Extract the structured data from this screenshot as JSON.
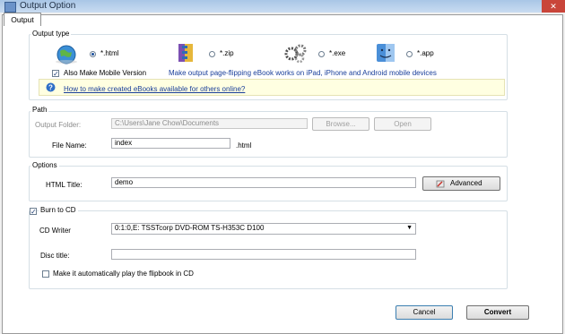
{
  "window": {
    "title": "Output Option",
    "close_glyph": "✕"
  },
  "tab": {
    "label": "Output"
  },
  "output_type": {
    "title": "Output type",
    "options": [
      {
        "label": "*.html",
        "selected": true
      },
      {
        "label": "*.zip",
        "selected": false
      },
      {
        "label": "*.exe",
        "selected": false
      },
      {
        "label": "*.app",
        "selected": false
      }
    ],
    "mobile_checkbox_label": "Also Make Mobile Version",
    "mobile_checked": true,
    "mobile_hint": "Make output page-flipping eBook works on iPad, iPhone and Android mobile devices",
    "help_link": "How to make created eBooks available for others online?"
  },
  "path": {
    "title": "Path",
    "output_folder_label": "Output Folder:",
    "output_folder_value": "C:\\Users\\Jane Chow\\Documents",
    "browse_label": "Browse...",
    "open_label": "Open",
    "file_name_label": "File Name:",
    "file_name_value": "index",
    "file_ext": ".html"
  },
  "options": {
    "title": "Options",
    "html_title_label": "HTML Title:",
    "html_title_value": "demo",
    "advanced_label": "Advanced"
  },
  "burn": {
    "checkbox_label": "Burn to CD",
    "checked": true,
    "cd_writer_label": "CD Writer",
    "cd_writer_value": "0:1:0,E: TSSTcorp DVD-ROM TS-H353C D100",
    "disc_title_label": "Disc title:",
    "disc_title_value": "",
    "autoplay_label": "Make it automatically play the flipbook in CD",
    "autoplay_checked": false
  },
  "footer": {
    "cancel_label": "Cancel",
    "convert_label": "Convert"
  },
  "colors": {
    "accent": "#1a3f9a",
    "titlebar": "#b9d1ec",
    "close": "#c9453a"
  }
}
